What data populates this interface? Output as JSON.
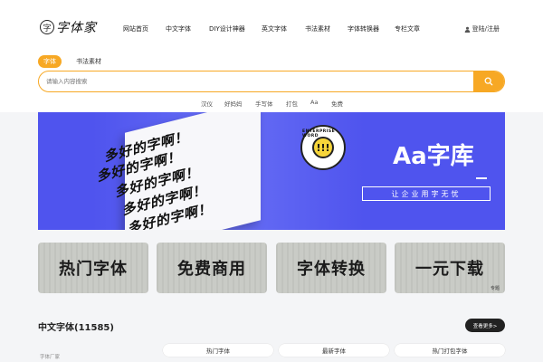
{
  "logo": {
    "mark": "字",
    "text": "字体家"
  },
  "nav": {
    "items": [
      {
        "label": "网站首页"
      },
      {
        "label": "中文字体"
      },
      {
        "label": "DIY设计神器"
      },
      {
        "label": "英文字体"
      },
      {
        "label": "书法素材"
      },
      {
        "label": "字体转换器"
      },
      {
        "label": "专栏文章"
      }
    ],
    "login_label": "登陆/注册"
  },
  "search": {
    "tabs": [
      {
        "label": "字体",
        "active": true
      },
      {
        "label": "书法素材",
        "active": false
      }
    ],
    "placeholder": "请输入内容搜索",
    "hot_keywords": [
      "汉仪",
      "好妈妈",
      "手写体",
      "打包",
      "Aa",
      "免费"
    ]
  },
  "banner": {
    "title": "Aa字库",
    "subtitle": "让企业用字无忧",
    "seal_text": "ENTERPRISE WORD",
    "seal_mark": "!!!",
    "paper_line": "多好的字啊！",
    "colors": {
      "background": "#4f54ee",
      "accent": "#f6d53a"
    }
  },
  "cards": [
    {
      "label": "热门字体",
      "tag": ""
    },
    {
      "label": "免费商用",
      "tag": ""
    },
    {
      "label": "字体转换",
      "tag": ""
    },
    {
      "label": "一元下载",
      "tag": "专题"
    }
  ],
  "section": {
    "title": "中文字体(11585)",
    "more_label": "查看更多>",
    "side_label": "字体厂家",
    "filter_tabs": [
      "热门字体",
      "最新字体",
      "热门打包字体"
    ]
  },
  "colors": {
    "accent": "#f7a824",
    "text": "#222222"
  }
}
